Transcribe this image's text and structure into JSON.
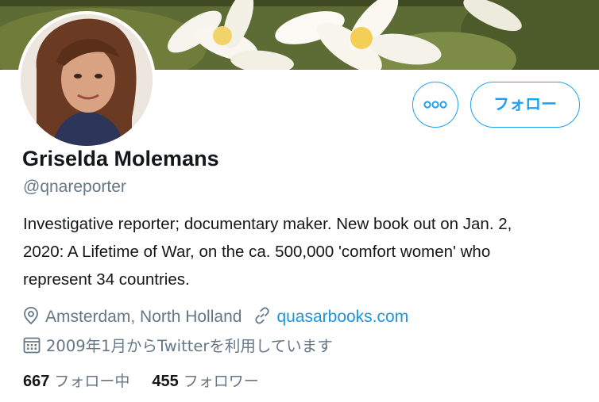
{
  "profile": {
    "display_name": "Griselda Molemans",
    "handle": "@qnareporter",
    "bio_lines": [
      "Investigative reporter; documentary maker. New book out on Jan. 2,",
      "2020: A Lifetime of War, on the ca. 500,000 'comfort women' who",
      "represent 34 countries."
    ],
    "location": "Amsterdam, North Holland",
    "website": "quasarbooks.com",
    "joined": "2009年1月からTwitterを利用しています"
  },
  "actions": {
    "follow_label": "フォロー",
    "more_icon": "more-icon"
  },
  "stats": {
    "following_count": "667",
    "following_label": "フォロー中",
    "followers_count": "455",
    "followers_label": "フォロワー"
  },
  "colors": {
    "accent": "#1da1f2",
    "link": "#1b95e0",
    "secondary_text": "#657786",
    "primary_text": "#14171a"
  },
  "icons": {
    "location": "location-pin-icon",
    "website": "link-icon",
    "joined": "calendar-icon"
  }
}
